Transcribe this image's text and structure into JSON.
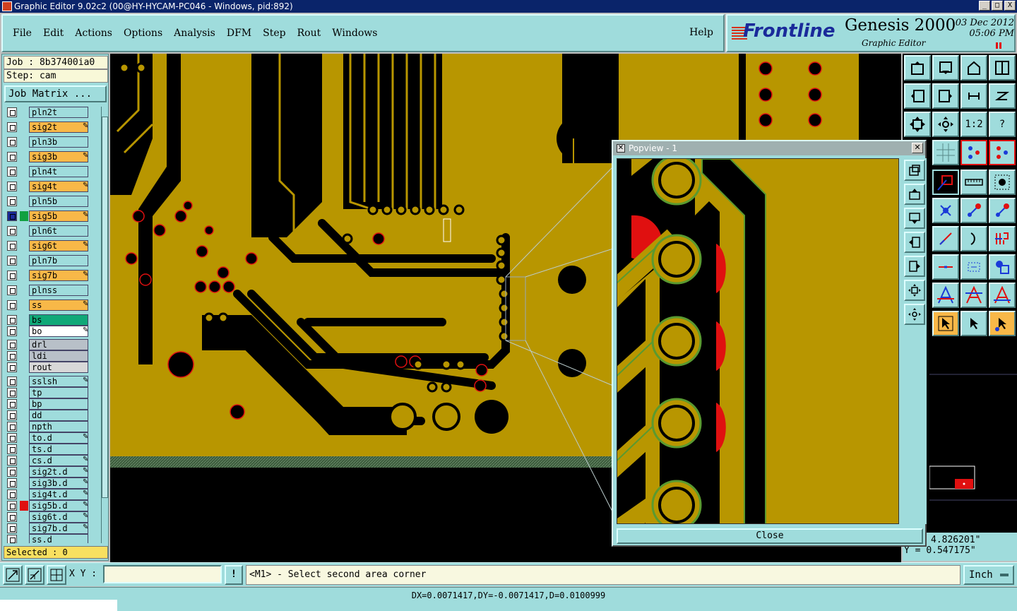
{
  "window": {
    "title": "Graphic Editor 9.02c2 (00@HY-HYCAM-PC046 - Windows, pid:892)",
    "buttons": [
      "_",
      "□",
      "X"
    ]
  },
  "menu": [
    "File",
    "Edit",
    "Actions",
    "Options",
    "Analysis",
    "DFM",
    "Step",
    "Rout",
    "Windows"
  ],
  "help": "Help",
  "logo": {
    "brand": "Frontline",
    "product": "Genesis 2000",
    "subtitle": "Graphic Editor",
    "date": "03  Dec  2012",
    "time": "05:06  PM"
  },
  "job": {
    "job_line": "Job : 8b37400ia0",
    "step_line": "Step: cam",
    "matrix_button": "Job Matrix ..."
  },
  "layers": [
    {
      "name": "pln2t",
      "color": "#9fdcdc",
      "pen": false
    },
    {
      "name": "sig2t",
      "color": "#f8b848",
      "pen": true
    },
    {
      "name": "pln3b",
      "color": "#9fdcdc",
      "pen": false
    },
    {
      "name": "sig3b",
      "color": "#f8b848",
      "pen": true
    },
    {
      "name": "pln4t",
      "color": "#9fdcdc",
      "pen": false
    },
    {
      "name": "sig4t",
      "color": "#f8b848",
      "pen": true
    },
    {
      "name": "pln5b",
      "color": "#9fdcdc",
      "pen": false
    },
    {
      "name": "sig5b",
      "color": "#f8b848",
      "pen": true,
      "active": true
    },
    {
      "name": "pln6t",
      "color": "#9fdcdc",
      "pen": false
    },
    {
      "name": "sig6t",
      "color": "#f8b848",
      "pen": true
    },
    {
      "name": "pln7b",
      "color": "#9fdcdc",
      "pen": false
    },
    {
      "name": "sig7b",
      "color": "#f8b848",
      "pen": true
    },
    {
      "name": "plnss",
      "color": "#9fdcdc",
      "pen": false
    },
    {
      "name": "ss",
      "color": "#f8b848",
      "pen": true
    },
    {
      "name": "bs",
      "color": "#10a878",
      "pen": false
    },
    {
      "name": "bo",
      "color": "#ffffff",
      "pen": true
    },
    {
      "name": "drl",
      "color": "#b8c0c8",
      "pen": false
    },
    {
      "name": "ldi",
      "color": "#b8c0c8",
      "pen": false
    },
    {
      "name": "rout",
      "color": "#d8d8d8",
      "pen": false
    },
    {
      "name": "sslsh",
      "color": "#9fdcdc",
      "pen": true
    },
    {
      "name": "tp",
      "color": "#9fdcdc",
      "pen": false
    },
    {
      "name": "bp",
      "color": "#9fdcdc",
      "pen": false
    },
    {
      "name": "dd",
      "color": "#9fdcdc",
      "pen": false
    },
    {
      "name": "npth",
      "color": "#9fdcdc",
      "pen": false
    },
    {
      "name": "to.d",
      "color": "#9fdcdc",
      "pen": true
    },
    {
      "name": "ts.d",
      "color": "#9fdcdc",
      "pen": false
    },
    {
      "name": "cs.d",
      "color": "#9fdcdc",
      "pen": true
    },
    {
      "name": "sig2t.d",
      "color": "#9fdcdc",
      "pen": true
    },
    {
      "name": "sig3b.d",
      "color": "#9fdcdc",
      "pen": true
    },
    {
      "name": "sig4t.d",
      "color": "#9fdcdc",
      "pen": true
    },
    {
      "name": "sig5b.d",
      "color": "#9fdcdc",
      "pen": true,
      "marker": "#e01010"
    },
    {
      "name": "sig6t.d",
      "color": "#9fdcdc",
      "pen": true
    },
    {
      "name": "sig7b.d",
      "color": "#9fdcdc",
      "pen": true
    },
    {
      "name": "ss.d",
      "color": "#9fdcdc",
      "pen": false
    }
  ],
  "selected": "Selected : 0",
  "popview": {
    "title": "Popview - 1",
    "close_label": "Close"
  },
  "coords": {
    "x": "4.826201\"",
    "y_label": "Y =",
    "y": "0.547175\""
  },
  "toolbar_right": {
    "ratio_label": "1:2",
    "help_label": "?"
  },
  "bottom": {
    "xy_label": "X Y :",
    "xy_value": "",
    "excl": "!",
    "prompt": "<M1> - Select second area corner",
    "unit": "Inch"
  },
  "status": "DX=0.0071417,DY=-0.0071417,D=0.0100999",
  "colors": {
    "board": "#b89600",
    "copper_void": "#000000",
    "pad_outline": "#e01010",
    "pad_green": "#5a9a30",
    "panel": "#9fdcdc"
  }
}
